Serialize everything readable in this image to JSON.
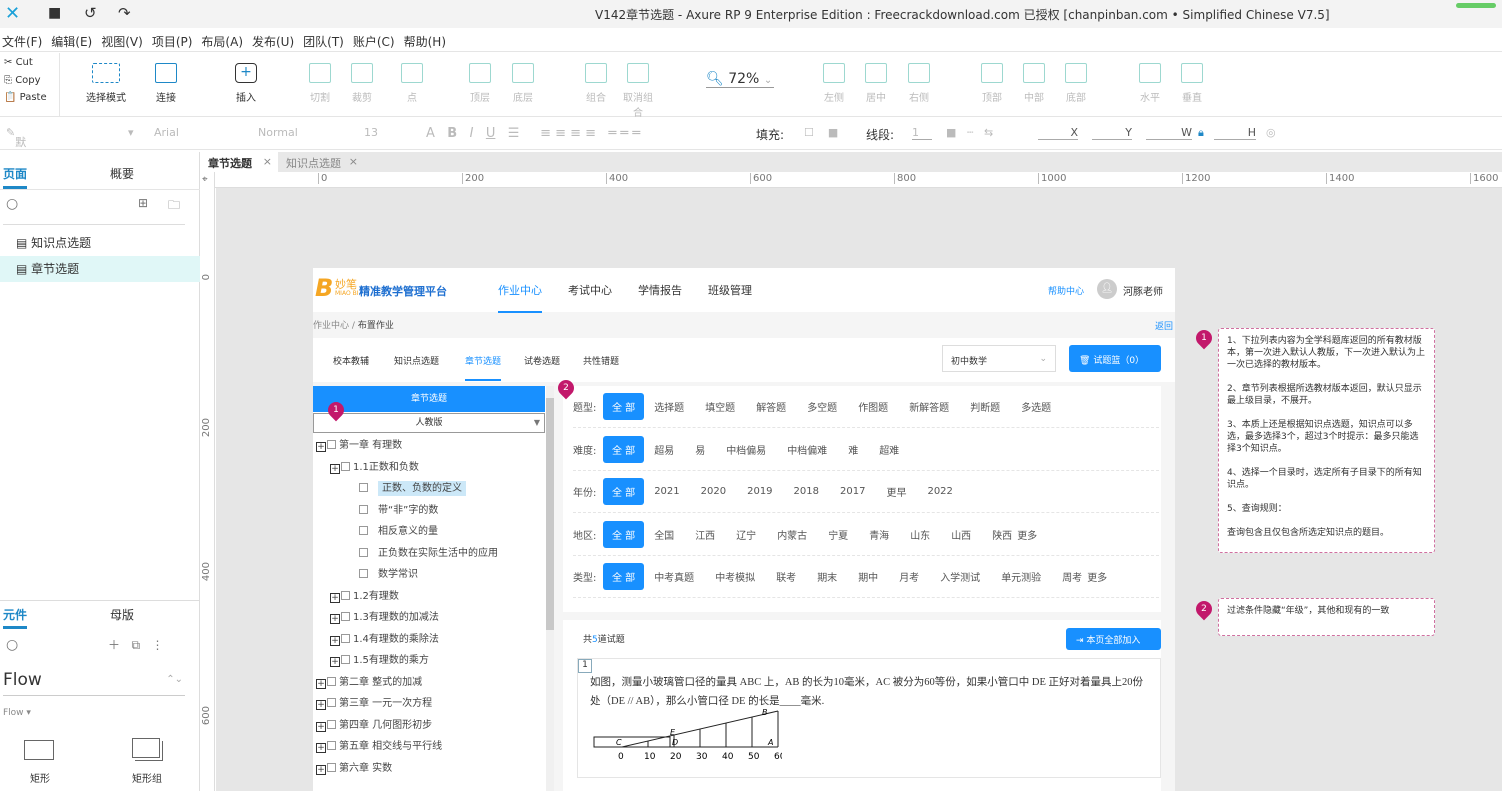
{
  "window": {
    "title": "V142章节选题 - Axure RP 9 Enterprise Edition : Freecrackdownload.com 已授权    [chanpinban.com • Simplified Chinese V7.5]"
  },
  "menu": [
    "文件(F)",
    "编辑(E)",
    "视图(V)",
    "项目(P)",
    "布局(A)",
    "发布(U)",
    "团队(T)",
    "账户(C)",
    "帮助(H)"
  ],
  "clipboard": {
    "cut": "Cut",
    "copy": "Copy",
    "paste": "Paste"
  },
  "toolbar": {
    "select_mode": "选择模式",
    "connect": "连接",
    "insert": "插入",
    "cut": "切割",
    "crop": "裁剪",
    "point": "点",
    "top_layer": "顶层",
    "bottom_layer": "底层",
    "group": "组合",
    "ungroup": "取消组合",
    "zoom": "72%",
    "left": "左侧",
    "center": "居中",
    "right": "右侧",
    "top": "顶部",
    "middle": "中部",
    "bottom": "底部",
    "horizontal": "水平",
    "vertical": "垂直"
  },
  "format": {
    "style": "默认",
    "font": "Arial",
    "weight": "Normal",
    "size": "13",
    "fill": "填充:",
    "line": "线段:",
    "line_width": "1",
    "x": "X",
    "y": "Y",
    "w": "W",
    "h": "H"
  },
  "pages_panel": {
    "tab_pages": "页面",
    "tab_outline": "概要",
    "pages": [
      "知识点选题",
      "章节选题"
    ],
    "selected": 1
  },
  "widgets_panel": {
    "tab_widgets": "元件",
    "tab_masters": "母版",
    "library": "Flow",
    "sub": "Flow ▾",
    "items": [
      "矩形",
      "矩形组"
    ]
  },
  "doc_tabs": [
    {
      "label": "章节选题",
      "active": true
    },
    {
      "label": "知识点选题",
      "active": false
    }
  ],
  "ruler": {
    "h": [
      "0",
      "200",
      "400",
      "600",
      "800",
      "1000",
      "1200",
      "1400",
      "1600"
    ],
    "v": [
      "0",
      "200",
      "400",
      "600"
    ]
  },
  "app": {
    "logo": "妙笔",
    "logo_sub": "MIAO BI",
    "platform": "精准教学管理平台",
    "nav": [
      "作业中心",
      "考试中心",
      "学情报告",
      "班级管理"
    ],
    "nav_active": 0,
    "help": "帮助中心",
    "user": "河豚老师",
    "breadcrumb": [
      "作业中心",
      "/",
      "布置作业"
    ],
    "back": "返回",
    "subtabs": [
      "校本教辅",
      "知识点选题",
      "章节选题",
      "试卷选题",
      "共性错题"
    ],
    "subtab_active": 2,
    "subject": "初中数学",
    "basket": "试题篮（0）",
    "tree_header": "章节选题",
    "edition": "人教版",
    "tree": [
      {
        "label": "第一章 有理数",
        "level": 0,
        "expand": true
      },
      {
        "label": "1.1正数和负数",
        "level": 1,
        "expand": true
      },
      {
        "label": "正数、负数的定义",
        "level": 2,
        "selected": true
      },
      {
        "label": "带“非”字的数",
        "level": 2
      },
      {
        "label": "相反意义的量",
        "level": 2
      },
      {
        "label": "正负数在实际生活中的应用",
        "level": 2
      },
      {
        "label": "数学常识",
        "level": 2
      },
      {
        "label": "1.2有理数",
        "level": 1,
        "expand": true
      },
      {
        "label": "1.3有理数的加减法",
        "level": 1,
        "expand": true
      },
      {
        "label": "1.4有理数的乘除法",
        "level": 1,
        "expand": true
      },
      {
        "label": "1.5有理数的乘方",
        "level": 1,
        "expand": true
      },
      {
        "label": "第二章 整式的加减",
        "level": 0,
        "expand": true
      },
      {
        "label": "第三章 一元一次方程",
        "level": 0,
        "expand": true
      },
      {
        "label": "第四章 几何图形初步",
        "level": 0,
        "expand": true
      },
      {
        "label": "第五章 相交线与平行线",
        "level": 0,
        "expand": true
      },
      {
        "label": "第六章 实数",
        "level": 0,
        "expand": true
      }
    ],
    "filters": [
      {
        "label": "题型:",
        "all": "全 部",
        "options": [
          "选择题",
          "填空题",
          "解答题",
          "多空题",
          "作图题",
          "新解答题",
          "判断题",
          "多选题"
        ]
      },
      {
        "label": "难度:",
        "all": "全 部",
        "options": [
          "超易",
          "易",
          "中档偏易",
          "中档偏难",
          "难",
          "超难"
        ]
      },
      {
        "label": "年份:",
        "all": "全 部",
        "options": [
          "2021",
          "2020",
          "2019",
          "2018",
          "2017",
          "更早",
          "2022"
        ]
      },
      {
        "label": "地区:",
        "all": "全 部",
        "options": [
          "全国",
          "江西",
          "辽宁",
          "内蒙古",
          "宁夏",
          "青海",
          "山东",
          "山西",
          "陕西"
        ],
        "more": "更多"
      },
      {
        "label": "类型:",
        "all": "全 部",
        "options": [
          "中考真题",
          "中考模拟",
          "联考",
          "期末",
          "期中",
          "月考",
          "入学测试",
          "单元测验",
          "周考"
        ],
        "more": "更多"
      }
    ],
    "count_pre": "共",
    "count": "5",
    "count_post": "道试题",
    "add_all": "本页全部加入",
    "question": {
      "no": "1",
      "text": "如图，测量小玻璃管口径的量具 ABC 上，AB 的长为10毫米，AC 被分为60等份，如果小管口中 DE 正好对着量具上20份处（DE // AB），那么小管口径 DE 的长是____毫米.",
      "ticks": [
        "0",
        "10",
        "20",
        "30",
        "40",
        "50",
        "60"
      ],
      "points": [
        "C",
        "D",
        "E",
        "B",
        "A"
      ]
    }
  },
  "notes": [
    {
      "no": "1",
      "lines": [
        "1、下拉列表内容为全学科题库返回的所有教材版本，第一次进入默认人教版，下一次进入默认为上一次已选择的教材版本。",
        "2、章节列表根据所选教材版本返回，默认只显示最上级目录，不展开。",
        "3、本质上还是根据知识点选题，知识点可以多选，最多选择3个，超过3个时提示：最多只能选择3个知识点。",
        "4、选择一个目录时，选定所有子目录下的所有知识点。",
        "5、查询规则：",
        "查询包含且仅包含所选定知识点的题目。"
      ]
    },
    {
      "no": "2",
      "lines": [
        "过滤条件隐藏“年级”，其他和现有的一致"
      ]
    }
  ],
  "colors": {
    "primary": "#1890ff",
    "note_pin": "#c2186b",
    "selected_page": "#e0f7f7"
  }
}
